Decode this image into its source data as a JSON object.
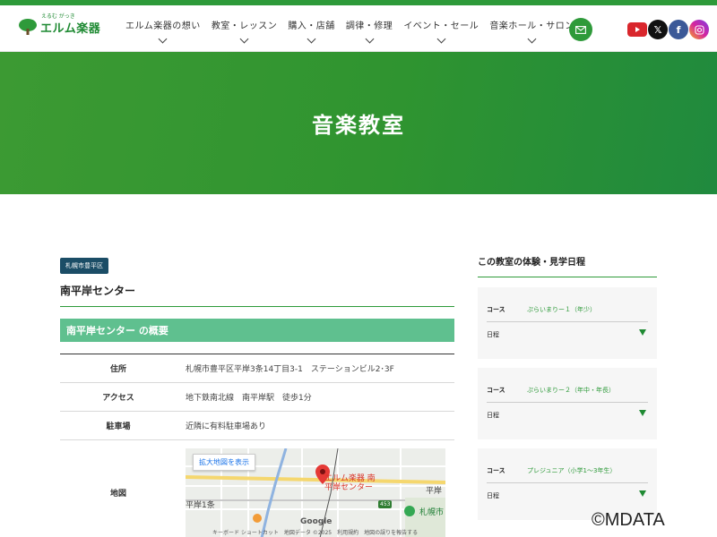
{
  "header": {
    "logo_text": "エルム楽器",
    "logo_sub": "えるむ がっき",
    "nav": [
      {
        "label": "エルム楽器の想い"
      },
      {
        "label": "教室・レッスン"
      },
      {
        "label": "購入・店舗"
      },
      {
        "label": "調律・修理"
      },
      {
        "label": "イベント・セール"
      },
      {
        "label": "音楽ホール・サロン"
      }
    ],
    "social": {
      "x": "𝕏",
      "facebook": "f"
    }
  },
  "hero": {
    "title": "音楽教室"
  },
  "main": {
    "badge": "札幌市豊平区",
    "center_title": "南平岸センター",
    "section_title": "南平岸センター の概要",
    "table": [
      {
        "label": "住所",
        "value": "札幌市豊平区平岸3条14丁目3-1　ステーションビル2･3F"
      },
      {
        "label": "アクセス",
        "value": "地下鉄南北線　南平岸駅　徒歩1分"
      },
      {
        "label": "駐車場",
        "value": "近隣に有料駐車場あり"
      },
      {
        "label": "地図"
      }
    ],
    "map": {
      "expand_label": "拡大地図を表示",
      "pin_label": "エルム楽器 南平岸センター",
      "label_left": "平岸1条",
      "label_right": "平岸",
      "label_poi": "札幌市",
      "route": "453",
      "google": "Google",
      "footer": "キーボード ショートカット　地図データ ©2025　利用規約　地図の誤りを報告する"
    }
  },
  "side": {
    "title": "この教室の体験・見学日程",
    "course_label": "コース",
    "date_label": "日程",
    "cards": [
      {
        "course": "ぷらいまりー１（年少）"
      },
      {
        "course": "ぷらいまりー２（年中・年長）"
      },
      {
        "course": "プレジュニア（小学1〜3年生）"
      }
    ]
  },
  "watermark": "©MDATA",
  "colors": {
    "brand_green": "#2e9a3a",
    "section_green": "#5fc08f",
    "badge_navy": "#1b4d66"
  }
}
